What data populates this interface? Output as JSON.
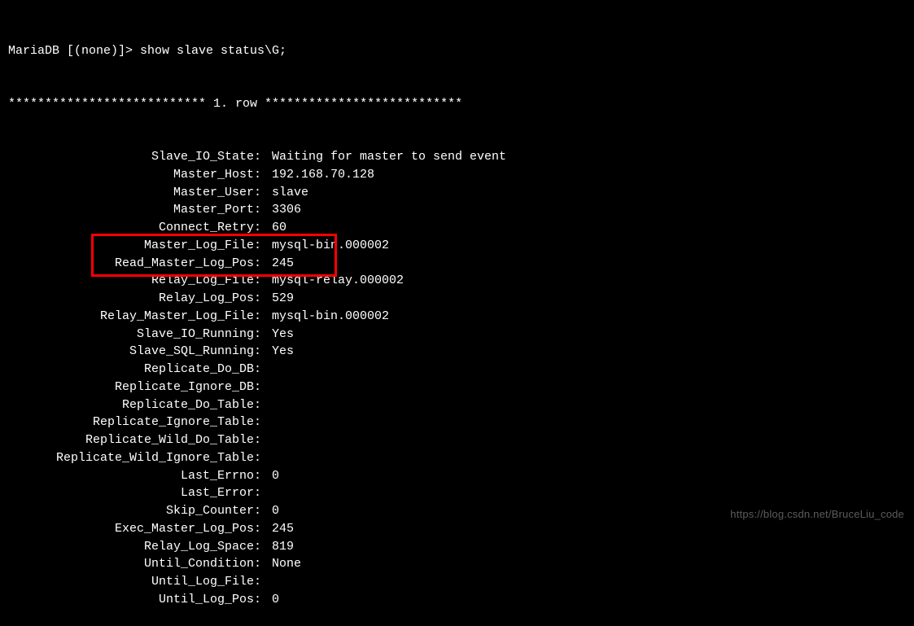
{
  "prompt": "MariaDB [(none)]> show slave status\\G;",
  "row_header": "*************************** 1. row ***************************",
  "status_lines": [
    {
      "label": "Slave_IO_State",
      "value": "Waiting for master to send event"
    },
    {
      "label": "Master_Host",
      "value": "192.168.70.128"
    },
    {
      "label": "Master_User",
      "value": "slave"
    },
    {
      "label": "Master_Port",
      "value": "3306"
    },
    {
      "label": "Connect_Retry",
      "value": "60"
    },
    {
      "label": "Master_Log_File",
      "value": "mysql-bin.000002"
    },
    {
      "label": "Read_Master_Log_Pos",
      "value": "245"
    },
    {
      "label": "Relay_Log_File",
      "value": "mysql-relay.000002"
    },
    {
      "label": "Relay_Log_Pos",
      "value": "529"
    },
    {
      "label": "Relay_Master_Log_File",
      "value": "mysql-bin.000002"
    },
    {
      "label": "Slave_IO_Running",
      "value": "Yes"
    },
    {
      "label": "Slave_SQL_Running",
      "value": "Yes"
    },
    {
      "label": "Replicate_Do_DB",
      "value": ""
    },
    {
      "label": "Replicate_Ignore_DB",
      "value": ""
    },
    {
      "label": "Replicate_Do_Table",
      "value": ""
    },
    {
      "label": "Replicate_Ignore_Table",
      "value": ""
    },
    {
      "label": "Replicate_Wild_Do_Table",
      "value": ""
    },
    {
      "label": "Replicate_Wild_Ignore_Table",
      "value": ""
    },
    {
      "label": "Last_Errno",
      "value": "0"
    },
    {
      "label": "Last_Error",
      "value": ""
    },
    {
      "label": "Skip_Counter",
      "value": "0"
    },
    {
      "label": "Exec_Master_Log_Pos",
      "value": "245"
    },
    {
      "label": "Relay_Log_Space",
      "value": "819"
    },
    {
      "label": "Until_Condition",
      "value": "None"
    },
    {
      "label": "Until_Log_File",
      "value": ""
    },
    {
      "label": "Until_Log_Pos",
      "value": "0"
    }
  ],
  "watermark": "https://blog.csdn.net/BruceLiu_code"
}
